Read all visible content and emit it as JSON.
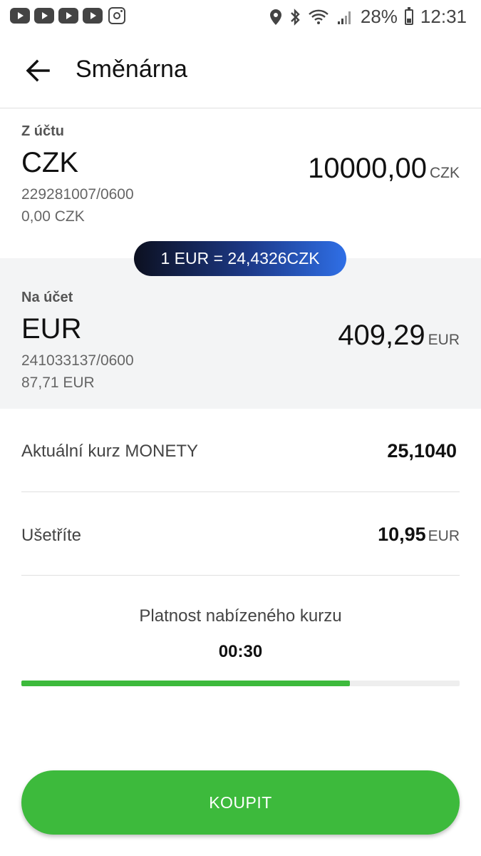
{
  "status_bar": {
    "battery_percent": "28%",
    "time": "12:31",
    "left_icons": [
      "youtube-icon",
      "youtube-icon",
      "youtube-icon",
      "youtube-icon",
      "instagram-icon"
    ],
    "right_icons": [
      "location-icon",
      "bluetooth-icon",
      "wifi-icon",
      "signal-icon",
      "battery-icon"
    ]
  },
  "header": {
    "title": "Směnárna",
    "back_icon": "arrow-left-icon"
  },
  "from_account": {
    "label": "Z účtu",
    "currency": "CZK",
    "account_number": "229281007/0600",
    "balance": "0,00 CZK",
    "amount": "10000,00",
    "amount_unit": "CZK"
  },
  "exchange_rate_badge": "1 EUR = 24,4326CZK",
  "to_account": {
    "label": "Na účet",
    "currency": "EUR",
    "account_number": "241033137/0600",
    "balance": "87,71 EUR",
    "amount": "409,29",
    "amount_unit": "EUR"
  },
  "rows": {
    "current_rate_label": "Aktuální kurz MONETY",
    "current_rate_value": "25,1040",
    "savings_label": "Ušetříte",
    "savings_value": "10,95",
    "savings_unit": "EUR"
  },
  "validity": {
    "label": "Platnost nabízeného kurzu",
    "timer": "00:30",
    "progress": 0.75
  },
  "buy_button": "KOUPIT",
  "colors": {
    "accent_green": "#3dba3c",
    "rate_gradient_start": "#0c1020",
    "rate_gradient_end": "#2f6fe6"
  }
}
